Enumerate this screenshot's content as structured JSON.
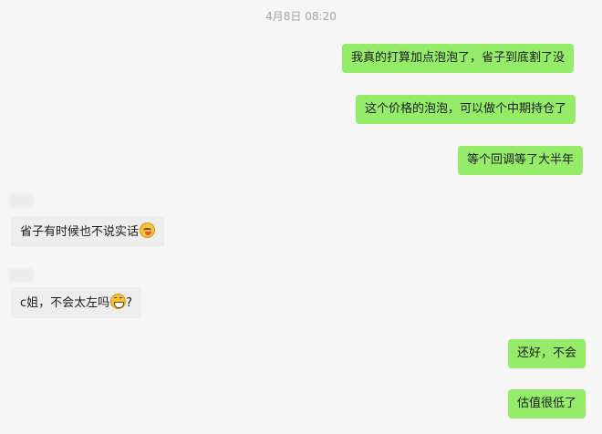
{
  "chat": {
    "timestamp": "4月8日 08:20",
    "messages": [
      {
        "sender": "me",
        "text": "我真的打算加点泡泡了，省子到底割了没"
      },
      {
        "sender": "me",
        "text": "这个价格的泡泡，可以做个中期持仓了"
      },
      {
        "sender": "me",
        "text": "等个回调等了大半年"
      },
      {
        "sender": "other",
        "text": "省子有时候也不说实话",
        "emoji": "lick-face-icon"
      },
      {
        "sender": "other",
        "text_before": "c姐，不会太左吗",
        "emoji": "grin-face-icon",
        "text_after": "?"
      },
      {
        "sender": "me",
        "text": "还好，不会"
      },
      {
        "sender": "me",
        "text": "估值很低了"
      }
    ]
  },
  "colors": {
    "outgoing_bubble": "#95ec69",
    "incoming_bubble": "#eeeeee",
    "background": "#f7f7f7",
    "timestamp_text": "#a3a3a3"
  }
}
